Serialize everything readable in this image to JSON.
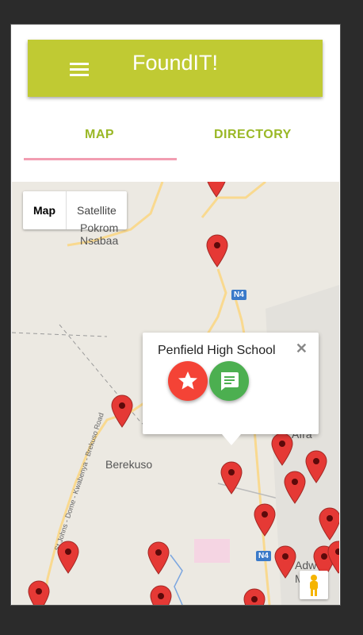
{
  "app": {
    "title": "FoundIT!"
  },
  "tabs": [
    {
      "label": "MAP"
    },
    {
      "label": "DIRECTORY"
    }
  ],
  "map": {
    "toggle": {
      "map_label": "Map",
      "satellite_label": "Satellite"
    },
    "labels": {
      "town1": "Nsabaa",
      "town1_partial": "Pokrom",
      "town2": "Berekuso",
      "town3_partial": "Afra",
      "town4_partial": "Adw",
      "town4_partial2": "Mu"
    },
    "roads": {
      "road1": "St Johns - Dome - Kwabenya - Brekuso Road",
      "shield1": "N4",
      "shield2": "N4"
    }
  },
  "popup": {
    "title": "Penfield High School",
    "close": "✕"
  },
  "colors": {
    "appbar": "#c0ca33",
    "tab_text": "#9ab826",
    "tab_indicator": "#f29db1",
    "pin": "#e53935",
    "fab_star": "#f44336",
    "fab_chat": "#4caf50"
  },
  "icons": [
    "menu-icon",
    "star-icon",
    "chat-icon",
    "close-icon",
    "pegman-icon",
    "map-pin-icon"
  ]
}
